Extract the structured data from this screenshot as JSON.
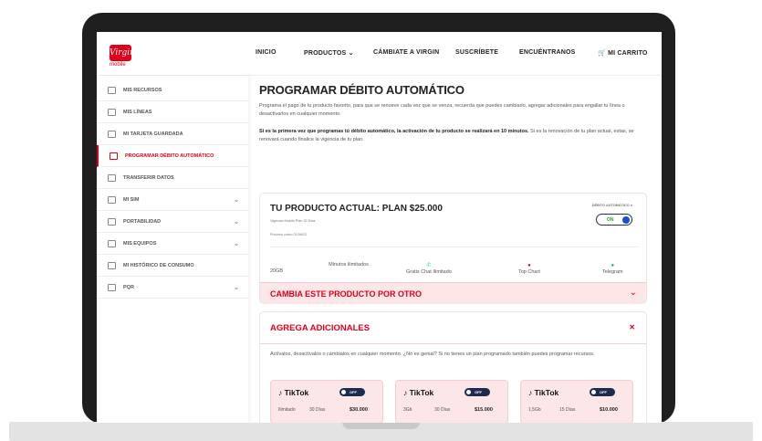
{
  "brand": {
    "logo_text": "Virgin",
    "logo_sub": "mobile",
    "accent": "#e1001a"
  },
  "nav": {
    "inicio": "INICIO",
    "productos": "PRODUCTOS",
    "cambiate": "CÁMBIATE A VIRGIN",
    "suscribete": "SUSCRÍBETE",
    "encuentranos": "ENCUÉNTRANOS",
    "carrito": "MI CARRITO"
  },
  "sidebar": {
    "items": [
      {
        "label": "MIS RECURSOS"
      },
      {
        "label": "MIS LÍNEAS"
      },
      {
        "label": "MI TARJETA GUARDADA"
      },
      {
        "label": "PROGRAMAR DÉBITO AUTOMÁTICO"
      },
      {
        "label": "TRANSFERIR DATOS"
      },
      {
        "label": "MI SIM"
      },
      {
        "label": "PORTABILIDAD"
      },
      {
        "label": "MIS EQUIPOS"
      },
      {
        "label": "MI HISTÓRICO DE CONSUMO"
      },
      {
        "label": "PQR"
      }
    ]
  },
  "main": {
    "title": "PROGRAMAR DÉBITO AUTOMÁTICO",
    "intro": "Programa el pago de tu producto favorito, para que se renueve cada vez que se venza, recuerda que puedes cambiarlo, agregar adicionales para engallar tu línea o desactivarlos en cualquier momento.",
    "note_bold": "Si es la primera vez que programas tú débito automático, la activación de tu producto se realizará en 10 minutos.",
    "note_rest": " Si es la renovación de tu plan actual, estas, se renovará cuando finalice la vigencia de tu plan."
  },
  "product": {
    "title": "TU PRODUCTO ACTUAL: PLAN $25.000",
    "vigencia": "Vigencia Mobile Plan 30 Días",
    "proximo": "Próximo cobro 01/06/22",
    "debito_label": "DÉBITO AUTOMÁTICO",
    "toggle_state": "ON",
    "features": [
      {
        "icon": "",
        "text": "20GB"
      },
      {
        "icon": "",
        "text": "Minutos ilimitados"
      },
      {
        "icon": "✆",
        "text": "Gratis Chat Ilimitado"
      },
      {
        "icon": "●",
        "text": "Top Chart"
      },
      {
        "icon": "●",
        "text": "Telegram"
      }
    ],
    "change_label": "CAMBIA ESTE PRODUCTO POR OTRO"
  },
  "addons": {
    "title": "AGREGA ADICIONALES",
    "desc": "Actívalos, desactívalos o cámbialos en cualquier momento. ¿No es genial? Si no tienes un plan programado también puedes programar recursos.",
    "cards": [
      {
        "name": "TikTok",
        "state": "OFF",
        "data": "Ilimitado",
        "days": "30 Días",
        "price": "$30.000"
      },
      {
        "name": "TikTok",
        "state": "OFF",
        "data": "3Gb",
        "days": "30 Días",
        "price": "$15.000"
      },
      {
        "name": "TikTok",
        "state": "OFF",
        "data": "1,5Gb",
        "days": "15 Días",
        "price": "$10.000"
      }
    ]
  }
}
